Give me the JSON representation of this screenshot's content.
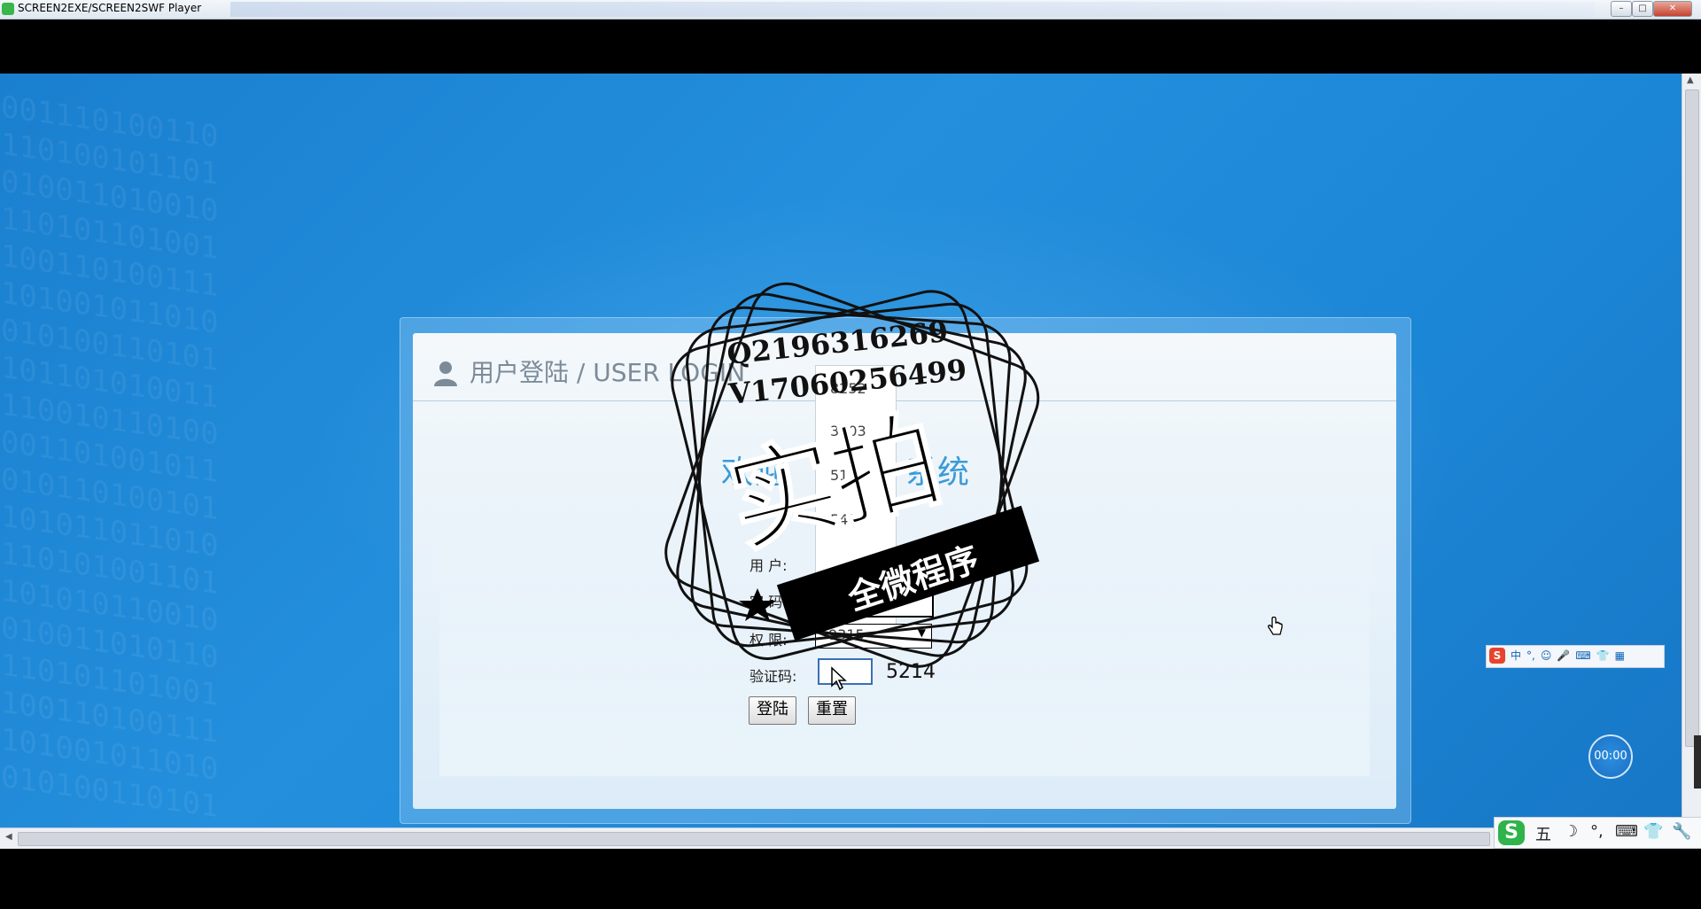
{
  "window": {
    "title": "SCREEN2EXE/SCREEN2SWF Player",
    "buttons": {
      "minimize": "–",
      "maximize": "□",
      "close": "✕"
    }
  },
  "login": {
    "header_title": "用户登陆 / USER LOGIN",
    "system_title_left": "欢迎",
    "system_title_right": "系统",
    "fields": {
      "user_label": "用 户:",
      "password_label": "密 码:",
      "role_label": "权 限:",
      "captcha_label": "验证码:"
    },
    "code_options": [
      "8252",
      "3103",
      "5156",
      "5497"
    ],
    "role_selected": "9315",
    "captcha_code": "5214",
    "buttons": {
      "login": "登陆",
      "reset": "重置"
    }
  },
  "watermark": {
    "qq": "Q2196316269",
    "vx": "V17060256499",
    "big_text": "实拍",
    "ribbon_text": "全微程序"
  },
  "player": {
    "timer": "00:00"
  },
  "ime": {
    "float_bar": [
      "中",
      "°,",
      "☺",
      "🎤",
      "⌨",
      "👕",
      "▦"
    ],
    "tray_items": [
      "五",
      "☽",
      "°,",
      "⌨",
      "👕",
      "🔧"
    ]
  }
}
